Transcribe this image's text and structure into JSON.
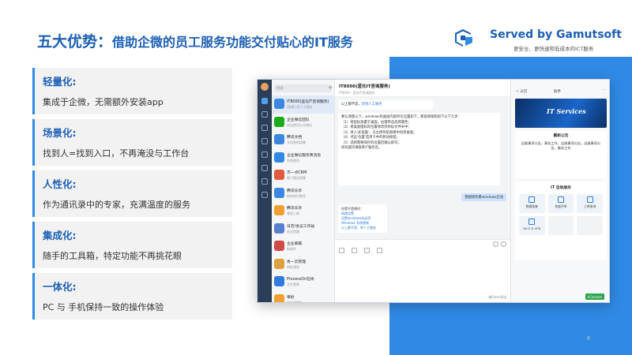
{
  "slide": {
    "title": "五大优势：",
    "subtitle": "借助企微的员工服务功能交付贴心的IT服务",
    "page_number": "6"
  },
  "brand": {
    "name": "Served by Gamutsoft",
    "tagline": "更安全、更快速和低成本的ICT服务",
    "color": "#1c5fb5"
  },
  "features": [
    {
      "title": "轻量化:",
      "desc": "集成于企微，无需额外安装app"
    },
    {
      "title": "场景化:",
      "desc": "找到人=找到入口，不再淹没与工作台"
    },
    {
      "title": "人性化:",
      "desc": "作为通讯录中的专家，充满温度的服务"
    },
    {
      "title": "集成化:",
      "desc": "随手的工具箱，特定功能不再挑花眼"
    },
    {
      "title": "一体化:",
      "desc": "PC 与 手机保持一致的操作体验"
    }
  ],
  "app": {
    "search_placeholder": "搜索",
    "conversations": [
      {
        "name": "IT8000(蓝化IT咨询服务)",
        "preview": "[链接] 转人工服务",
        "color": "#3b86e0"
      },
      {
        "name": "企业微信团队",
        "preview": "欢迎使用企业微信",
        "color": "#1aad19"
      },
      {
        "name": "腾讯文档",
        "preview": "文档更新提醒",
        "color": "#3b86e0"
      },
      {
        "name": "企业微信服务商消息",
        "preview": "系统通知",
        "color": "#2f8ae6"
      },
      {
        "name": "杰一点CRM",
        "preview": "客户跟进提醒",
        "color": "#e05a3b"
      },
      {
        "name": "腾讯乐享",
        "preview": "新的知识推荐",
        "color": "#3b86e0"
      },
      {
        "name": "腾讯乐享",
        "preview": "课程上新",
        "color": "#f0a030"
      },
      {
        "name": "日历/会议工作站",
        "preview": "会议提醒",
        "color": "#5a7fd0"
      },
      {
        "name": "企业邮箱",
        "preview": "新邮件",
        "color": "#d04a4a"
      },
      {
        "name": "易一云管理",
        "preview": "审批通知",
        "color": "#e0a03b"
      },
      {
        "name": "ProcessOn在线",
        "preview": "文件更新",
        "color": "#2f7be0"
      },
      {
        "name": "审批",
        "preview": "待处理审批",
        "color": "#f0a030"
      },
      {
        "name": "WiKi",
        "preview": "知识库",
        "color": "#3b86e0"
      },
      {
        "name": "微盘",
        "preview": "文件同步",
        "color": "#3b86e0"
      }
    ],
    "chat": {
      "title": "IT8000(蓝化IT咨询服务)",
      "subtitle": "IT8000 · 蓝化IT咨询服务",
      "transfer_msg": "以上都不是，",
      "transfer_link": "转到人工服务",
      "answer_lines": [
        "要认清楚以下，windows的桌面内容所在位置如下，那就请按照如下以下几步：",
        "（1）将鼠标放置于桌面，右键单击选择属性；",
        "（2）将桌面图标的位置修改到目标文件夹中；",
        "（3）进入'此电脑'，在左侧导航窗格中找到桌面；",
        "（4）点击'位置'选项卡中的移动按钮；",
        "（5）选择需要保存的位置后确认即可。",
        "如有疑问请联系IT服务台。"
      ],
      "user_msg": "我想修改重windows启动",
      "reply_title": "你是不是想问：",
      "reply_links": [
        "网络设置",
        "设置windows启动项",
        "Windows 系统更新",
        "以上都不是，转人工服务"
      ],
      "send_hint": "按Enter发送"
    },
    "phone": {
      "back": "< 返回",
      "title": "助手",
      "menu": "···",
      "banner_text": "IT Services",
      "notice_title": "最新公告",
      "notice_text": "运维事项公告，事务工作，运维事项公告，运维事项公告，事务工作",
      "portal_title": "IT 自助服务",
      "tiles": [
        "数据恢复",
        "快速开单",
        "工单查询",
        "Wi-Fi & VPN",
        "",
        ""
      ],
      "button": "eConsole"
    }
  }
}
